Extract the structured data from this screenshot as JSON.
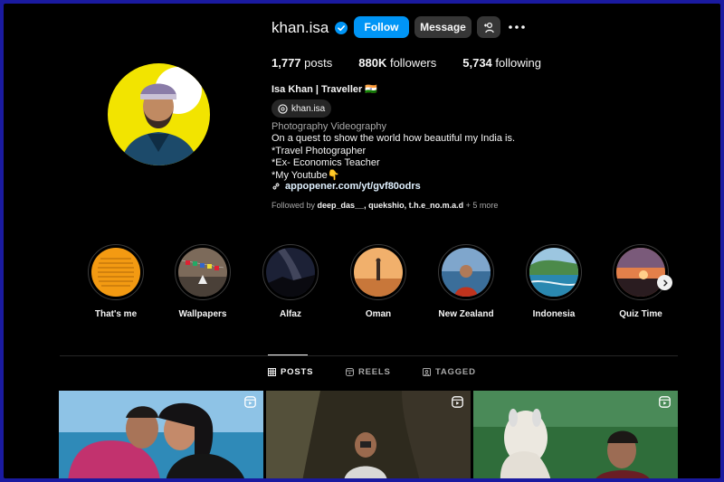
{
  "profile": {
    "username": "khan.isa",
    "follow_label": "Follow",
    "message_label": "Message",
    "stats": [
      {
        "value": "1,777",
        "label": "posts"
      },
      {
        "value": "880K",
        "label": "followers"
      },
      {
        "value": "5,734",
        "label": "following"
      }
    ],
    "full_name": "Isa Khan | Traveller 🇮🇳",
    "threads_handle": "khan.isa",
    "category": "Photography Videography",
    "bio_lines": [
      "On a quest to show the world how beautiful my India is.",
      "*Travel Photographer",
      "*Ex- Economics Teacher",
      "*My Youtube👇"
    ],
    "link": "appopener.com/yt/gvf80odrs",
    "followed_by_prefix": "Followed by",
    "followed_by_names": "deep_das__, quekshio, t.h.e_no.m.a.d",
    "followed_by_more": "+ 5 more"
  },
  "highlights": [
    {
      "label": "That's me",
      "icon": "text-story-thumbnail"
    },
    {
      "label": "Wallpapers",
      "icon": "flags-thumbnail"
    },
    {
      "label": "Alfaz",
      "icon": "night-sky-thumbnail"
    },
    {
      "label": "Oman",
      "icon": "desert-thumbnail"
    },
    {
      "label": "New Zealand",
      "icon": "lake-portrait-thumbnail"
    },
    {
      "label": "Indonesia",
      "icon": "coast-thumbnail"
    },
    {
      "label": "Quiz Time",
      "icon": "sunset-thumbnail"
    }
  ],
  "tabs": [
    {
      "label": "POSTS",
      "icon": "grid-icon",
      "active": true
    },
    {
      "label": "REELS",
      "icon": "reels-icon",
      "active": false
    },
    {
      "label": "TAGGED",
      "icon": "tag-icon",
      "active": false
    }
  ],
  "colors": {
    "background": "#000000",
    "follow_button": "#0095f6",
    "secondary_button": "#363636",
    "verified": "#0095f6",
    "muted_text": "#a8a8a8",
    "frame": "#1a1aa0"
  }
}
